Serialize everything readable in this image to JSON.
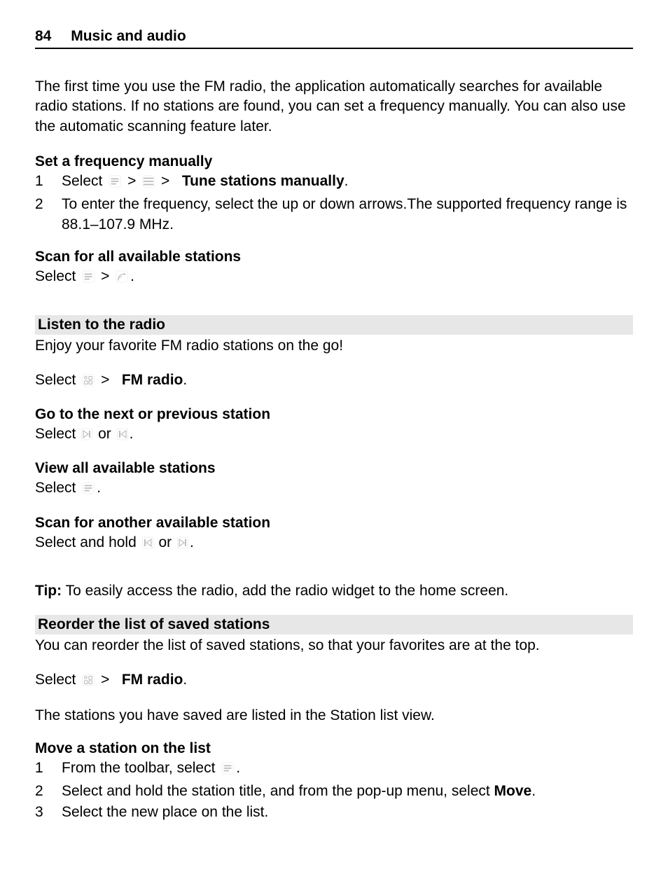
{
  "header": {
    "page_number": "84",
    "chapter": "Music and audio"
  },
  "intro": "The first time you use the FM radio, the application automatically searches for available radio stations. If no stations are found, you can set a frequency manually. You can also use the automatic scanning feature later.",
  "set_freq": {
    "heading": "Set a frequency manually",
    "step1_select": "Select",
    "gt": ">",
    "step1_bold": "Tune stations manually",
    "step1_end": ".",
    "step2": "To enter the frequency, select the up or down arrows.The supported frequency range is 88.1–107.9 MHz.",
    "n1": "1",
    "n2": "2"
  },
  "scan_all": {
    "heading": "Scan for all available stations",
    "select": "Select",
    "gt": ">",
    "end": "."
  },
  "listen": {
    "heading": "Listen to the radio",
    "body": "Enjoy your favorite FM radio stations on the go!",
    "select": "Select",
    "gt": ">",
    "bold": "FM radio",
    "end": "."
  },
  "next_prev": {
    "heading": "Go to the next or previous station",
    "select": "Select",
    "or": "or",
    "end": "."
  },
  "view_all": {
    "heading": "View all available stations",
    "select": "Select",
    "end": "."
  },
  "scan_another": {
    "heading": "Scan for another available station",
    "select": "Select and hold",
    "or": "or",
    "end": "."
  },
  "tip": {
    "label": "Tip:",
    "text": " To easily access the radio, add the radio widget to the home screen."
  },
  "reorder": {
    "heading": "Reorder the list of saved stations",
    "body": "You can reorder the list of saved stations, so that your favorites are at the top.",
    "select": "Select",
    "gt": ">",
    "bold": "FM radio",
    "end": ".",
    "listed": "The stations you have saved are listed in the Station list view."
  },
  "move": {
    "heading": "Move a station on the list",
    "n1": "1",
    "n2": "2",
    "n3": "3",
    "step1_a": "From the toolbar, select",
    "step1_b": ".",
    "step2_a": "Select and hold the station title, and from the pop-up menu, select ",
    "step2_bold": "Move",
    "step2_b": ".",
    "step3": "Select the new place on the list."
  }
}
